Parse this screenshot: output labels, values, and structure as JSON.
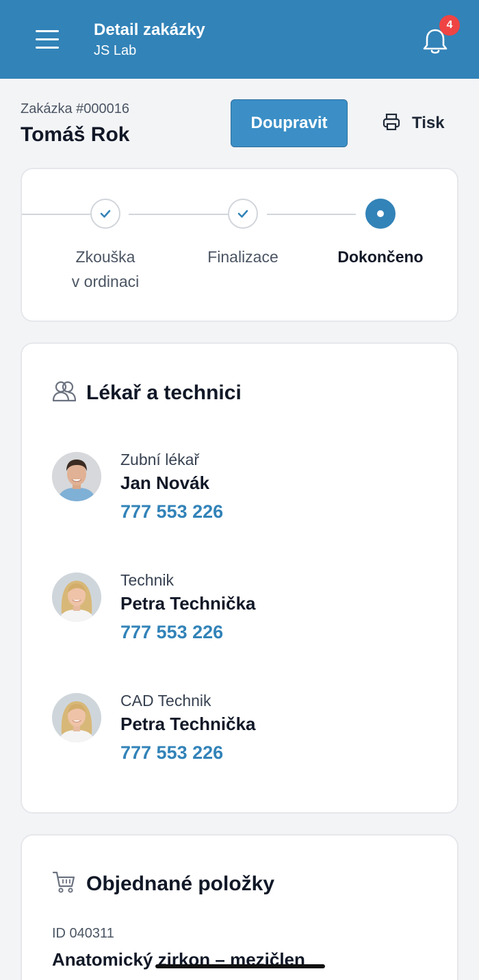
{
  "header": {
    "title": "Detail zakázky",
    "subtitle": "JS Lab",
    "notification_count": "4",
    "menu_icon": "hamburger-menu-icon",
    "bell_icon": "bell-icon"
  },
  "order": {
    "id_label": "Zakázka #000016",
    "patient_name": "Tomáš Rok",
    "edit_label": "Doupravit",
    "print_label": "Tisk",
    "print_icon": "printer-icon"
  },
  "steps": [
    {
      "label_line1": "Zkouška",
      "label_line2": "v ordinaci",
      "state": "done"
    },
    {
      "label_line1": "Finalizace",
      "label_line2": "",
      "state": "done"
    },
    {
      "label_line1": "Dokončeno",
      "label_line2": "",
      "state": "current"
    }
  ],
  "team": {
    "title": "Lékař a technici",
    "icon": "users-icon",
    "people": [
      {
        "role": "Zubní lékař",
        "name": "Jan Novák",
        "phone": "777 553 226",
        "avatar": "male-avatar"
      },
      {
        "role": "Technik",
        "name": "Petra Technička",
        "phone": "777 553 226",
        "avatar": "female-avatar"
      },
      {
        "role": "CAD Technik",
        "name": "Petra Technička",
        "phone": "777 553 226",
        "avatar": "female-avatar"
      }
    ]
  },
  "items": {
    "title": "Objednané položky",
    "icon": "cart-icon",
    "first_item": {
      "id": "ID 040311",
      "name": "Anatomický zirkon – mezičlen"
    }
  },
  "colors": {
    "primary": "#3283b8",
    "badge": "#ef4444",
    "background": "#f3f4f6"
  }
}
